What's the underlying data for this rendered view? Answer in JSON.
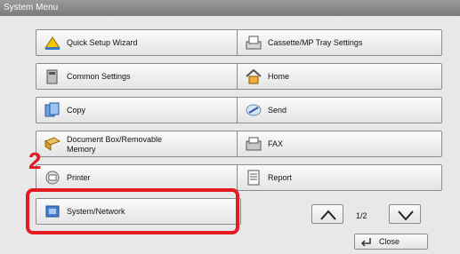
{
  "window": {
    "title": "System Menu"
  },
  "menu": {
    "quick_setup": "Quick Setup Wizard",
    "cassette": "Cassette/MP Tray Settings",
    "common": "Common Settings",
    "home": "Home",
    "copy": "Copy",
    "send": "Send",
    "docbox_line1": "Document Box/Removable",
    "docbox_line2": "Memory",
    "fax": "FAX",
    "printer": "Printer",
    "report": "Report",
    "system_network": "System/Network"
  },
  "step_number": "2",
  "pagination": {
    "current": "1/2"
  },
  "close_label": "Close",
  "colors": {
    "highlight": "#e31b23",
    "step_number": "#e31b23"
  }
}
